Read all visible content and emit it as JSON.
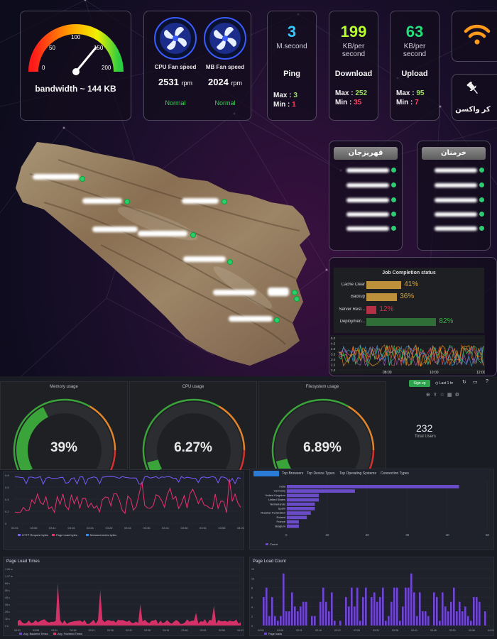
{
  "speedometer": {
    "ticks": [
      "0",
      "50",
      "100",
      "150",
      "200"
    ],
    "label": "bandwidth ~ 144 KB",
    "value": 144
  },
  "fans": [
    {
      "title": "CPU Fan speed",
      "rpm": "2531",
      "unit": "rpm",
      "status": "Normal"
    },
    {
      "title": "MB Fan speed",
      "rpm": "2024",
      "unit": "rpm",
      "status": "Normal"
    }
  ],
  "metrics": [
    {
      "value": "3",
      "unit": [
        "M.second"
      ],
      "name": "Ping",
      "max_label": "Max :",
      "max": "3",
      "min_label": "Min :",
      "min": "1",
      "color": "#35c9ff"
    },
    {
      "value": "199",
      "unit": [
        "KB/per",
        "second"
      ],
      "name": "Download",
      "max_label": "Max :",
      "max": "252",
      "min_label": "Min :",
      "min": "35",
      "color": "#b8ff2e"
    },
    {
      "value": "63",
      "unit": [
        "KB/per",
        "second"
      ],
      "name": "Upload",
      "max_label": "Max :",
      "max": "95",
      "min_label": "Min :",
      "min": "7",
      "color": "#24e07a"
    }
  ],
  "pin_card": {
    "label": "کر واکسن"
  },
  "provinces": [
    {
      "name": "قهریزجان",
      "items": 5
    },
    {
      "name": "خرمنان",
      "items": 5
    }
  ],
  "job_completion": {
    "title": "Job Completion status",
    "jobs": [
      {
        "label": "Cache Clear",
        "percent": 41,
        "text": "41%",
        "color": "#d9a640"
      },
      {
        "label": "Backup",
        "percent": 36,
        "text": "36%",
        "color": "#d9a640"
      },
      {
        "label": "Server Rest...",
        "percent": 12,
        "text": "12%",
        "color": "#d0344a"
      },
      {
        "label": "Deploymen...",
        "percent": 82,
        "text": "82%",
        "color": "#3fae4a"
      }
    ]
  },
  "mini_timeseries": {
    "y_ticks": [
      "5.0",
      "4.5",
      "4.0",
      "3.5",
      "3.0",
      "2.5",
      "2.0"
    ],
    "x_ticks": [
      "08:00",
      "10:00",
      "12:00"
    ]
  },
  "gauges": [
    {
      "title": "Memory usage",
      "value": 39,
      "text": "39%"
    },
    {
      "title": "CPU usage",
      "value": 6.27,
      "text": "6.27%"
    },
    {
      "title": "Filesystem usage",
      "value": 6.89,
      "text": "6.89%"
    }
  ],
  "top_bar": {
    "signup": "Sign up",
    "range": "Last 1 hr"
  },
  "total_users": {
    "value": "232",
    "label": "Total Users"
  },
  "line_chart": {
    "x_ticks": [
      "03:01",
      "03:06",
      "03:11",
      "03:16",
      "03:21",
      "03:26",
      "03:31",
      "03:36",
      "03:41",
      "03:46",
      "03:51",
      "03:56",
      "04:01"
    ],
    "y_ticks": [
      "0.8",
      "0.6",
      "0.4",
      "0.2",
      "0"
    ],
    "legend": [
      "HTTP Request bytes",
      "Page Load bytes",
      "Measurements bytes"
    ],
    "legend_colors": [
      "#7a5cff",
      "#e8336f",
      "#2a8cff"
    ]
  },
  "country_chart": {
    "tabs": [
      "Top Browsers",
      "Top Device Types",
      "Top Operating Systems",
      "Connection Types"
    ],
    "countries": [
      "India",
      "Germany",
      "United Kingdom",
      "United States",
      "Netherlands",
      "Spain",
      "Russian Federation",
      "Poland",
      "France",
      "Belgium"
    ],
    "values": [
      43,
      17,
      8,
      8,
      7,
      7,
      6,
      5,
      3,
      3
    ],
    "x_ticks": [
      "0",
      "10",
      "20",
      "30",
      "40",
      "50"
    ],
    "legend": "Count"
  },
  "page_load_times": {
    "title": "Page Load Times",
    "y_ticks": [
      "1.26 m",
      "1.17 m",
      "60 s",
      "50 s",
      "40 s",
      "30 s",
      "20 s",
      "10 s",
      "0 s"
    ],
    "x_ticks": [
      "03:01",
      "03:06",
      "03:11",
      "03:16",
      "03:21",
      "03:26",
      "03:31",
      "03:36",
      "03:41",
      "03:46",
      "03:51",
      "03:56",
      "04:01"
    ],
    "legend": [
      "Avg. Backend Times",
      "Avg. Frontend Times"
    ]
  },
  "page_load_count": {
    "title": "Page Load Count",
    "y_ticks": [
      "12",
      "10",
      "8",
      "6",
      "4",
      "2",
      "0"
    ],
    "x_ticks": [
      "03:01",
      "03:06",
      "03:11",
      "03:16",
      "03:21",
      "03:26",
      "03:31",
      "03:36",
      "03:41",
      "03:46",
      "03:51",
      "03:56",
      "04:01"
    ],
    "legend": "Page loads"
  }
}
